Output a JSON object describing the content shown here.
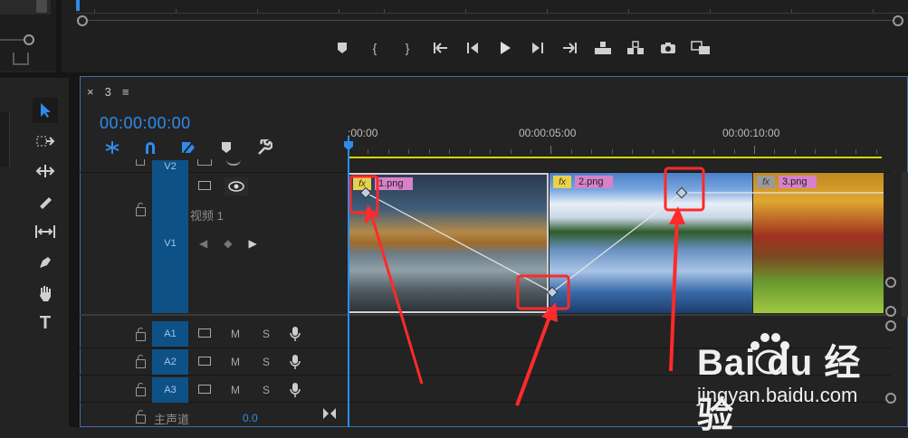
{
  "tab": {
    "close": "×",
    "title": "3",
    "menu": "≡"
  },
  "timecode": "00:00:00:00",
  "ruler": {
    "labels": [
      ":00:00",
      "00:00:05:00",
      "00:00:10:00"
    ]
  },
  "tracks": {
    "v2": {
      "label": "V2"
    },
    "v1": {
      "label": "V1",
      "name": "视频 1"
    },
    "a1": {
      "label": "A1",
      "m": "M",
      "s": "S"
    },
    "a2": {
      "label": "A2",
      "m": "M",
      "s": "S"
    },
    "a3": {
      "label": "A3",
      "m": "M",
      "s": "S"
    },
    "master": {
      "label": "主声道",
      "value": "0.0"
    }
  },
  "clips": [
    {
      "fx": "fx",
      "name": "1.png"
    },
    {
      "fx": "fx",
      "name": "2.png"
    },
    {
      "fx": "fx",
      "name": "3.png"
    }
  ],
  "watermark": {
    "brand": "Bai du 经验",
    "url": "jingyan.baidu.com"
  },
  "colors": {
    "accent": "#2d8ceb",
    "highlight": "#ff2a2a",
    "track_label": "#0e5186",
    "clip_label": "#d781c9",
    "fx_badge": "#e8d24a"
  }
}
